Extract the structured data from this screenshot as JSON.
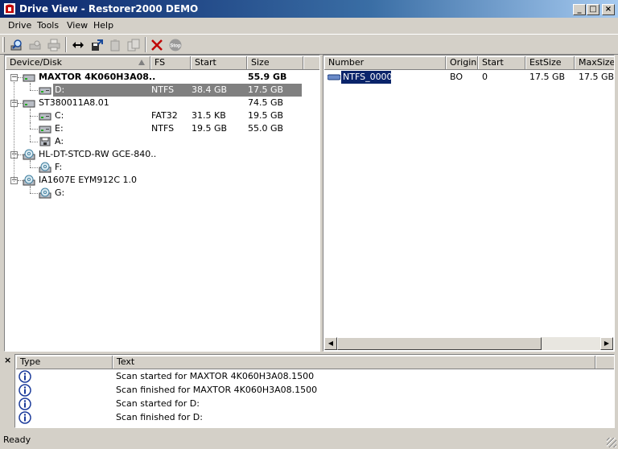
{
  "window": {
    "title": "Drive View - Restorer2000 DEMO",
    "buttons": {
      "minimize": "_",
      "maximize": "□",
      "close": "×"
    }
  },
  "menu": [
    "Drive",
    "Tools",
    "View",
    "Help"
  ],
  "toolbar": {
    "icons": [
      "search-drive",
      "scan",
      "print",
      "swap",
      "export",
      "clipboard",
      "copy",
      "delete",
      "stop"
    ],
    "stop_label": "Stop"
  },
  "device_panel": {
    "columns": [
      "Device/Disk",
      "FS",
      "Start",
      "Size"
    ],
    "rows": [
      {
        "name": "MAXTOR 4K060H3A08....",
        "fs": "",
        "start": "",
        "size": "55.9 GB",
        "bold": true,
        "type": "disk"
      },
      {
        "name": "D:",
        "fs": "NTFS",
        "start": "38.4 GB",
        "size": "17.5 GB",
        "selected": true,
        "type": "partition"
      },
      {
        "name": "ST380011A8.01",
        "fs": "",
        "start": "",
        "size": "74.5 GB",
        "type": "disk"
      },
      {
        "name": "C:",
        "fs": "FAT32",
        "start": "31.5 KB",
        "size": "19.5 GB",
        "type": "partition"
      },
      {
        "name": "E:",
        "fs": "NTFS",
        "start": "19.5 GB",
        "size": "55.0 GB",
        "type": "partition"
      },
      {
        "name": "A:",
        "fs": "",
        "start": "",
        "size": "",
        "type": "floppy"
      },
      {
        "name": "HL-DT-STCD-RW GCE-840...",
        "fs": "",
        "start": "",
        "size": "",
        "type": "cdrom"
      },
      {
        "name": "F:",
        "fs": "",
        "start": "",
        "size": "",
        "type": "cd-partition"
      },
      {
        "name": "IA1607E EYM912C 1.0",
        "fs": "",
        "start": "",
        "size": "",
        "type": "cdrom"
      },
      {
        "name": "G:",
        "fs": "",
        "start": "",
        "size": "",
        "type": "cd-partition"
      }
    ]
  },
  "partition_panel": {
    "columns": [
      "Number",
      "Origin",
      "Start",
      "EstSize",
      "MaxSize"
    ],
    "rows": [
      {
        "number": "NTFS_0000",
        "origin": "BO",
        "start": "0",
        "estsize": "17.5 GB",
        "maxsize": "17.5 GB"
      }
    ]
  },
  "log_panel": {
    "close_glyph": "×",
    "columns": [
      "Type",
      "Text"
    ],
    "rows": [
      {
        "type": "info",
        "text": "Scan started for MAXTOR 4K060H3A08.1500"
      },
      {
        "type": "info",
        "text": "Scan finished for MAXTOR 4K060H3A08.1500"
      },
      {
        "type": "info",
        "text": "Scan started for D:"
      },
      {
        "type": "info",
        "text": "Scan finished for D:"
      }
    ]
  },
  "status": {
    "text": "Ready"
  }
}
